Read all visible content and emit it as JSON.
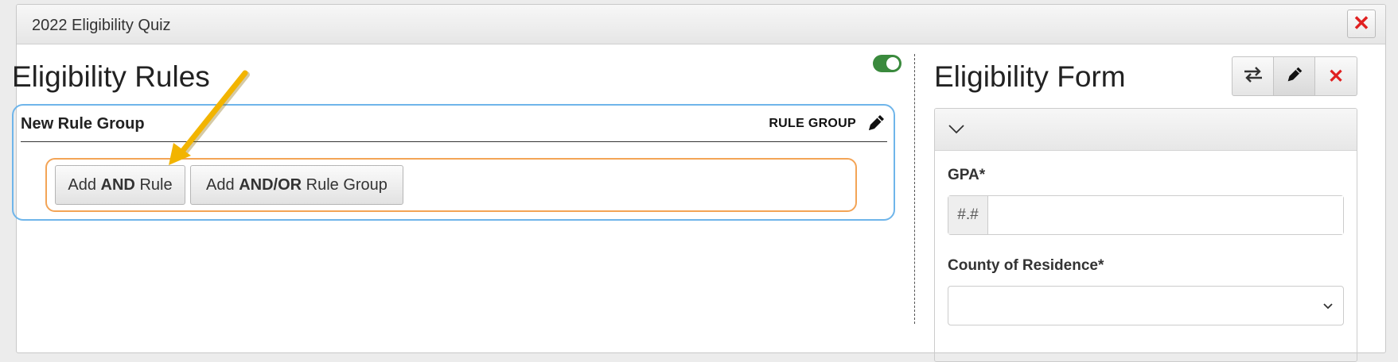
{
  "modal": {
    "title": "2022 Eligibility Quiz",
    "close_label": "✕"
  },
  "rules": {
    "title": "Eligibility Rules",
    "toggle_on": true,
    "group": {
      "name": "New Rule Group",
      "type_label": "RULE GROUP",
      "add_and_rule": {
        "pre": "Add ",
        "bold": "AND",
        "post": " Rule"
      },
      "add_andor_group": {
        "pre": "Add ",
        "bold": "AND/OR",
        "post": " Rule Group"
      }
    }
  },
  "form": {
    "title": "Eligibility Form",
    "toolbar": {
      "close_label": "✕"
    },
    "fields": {
      "gpa": {
        "label": "GPA*",
        "addon": "#.#",
        "value": ""
      },
      "county": {
        "label": "County of Residence*",
        "value": ""
      }
    }
  },
  "colors": {
    "accent_blue": "#6fb5ea",
    "accent_orange": "#f3a456",
    "toggle_green": "#3a8a3d",
    "close_red": "#e02020",
    "annotation_arrow": "#f2b400"
  },
  "icons": {
    "modal_close": "close-icon",
    "rule_group_edit": "pencil-icon",
    "toolbar_swap": "swap-icon",
    "toolbar_edit": "pencil-icon",
    "toolbar_delete": "close-icon",
    "panel_collapse": "chevron-down-icon",
    "select_caret": "chevron-down-icon"
  }
}
